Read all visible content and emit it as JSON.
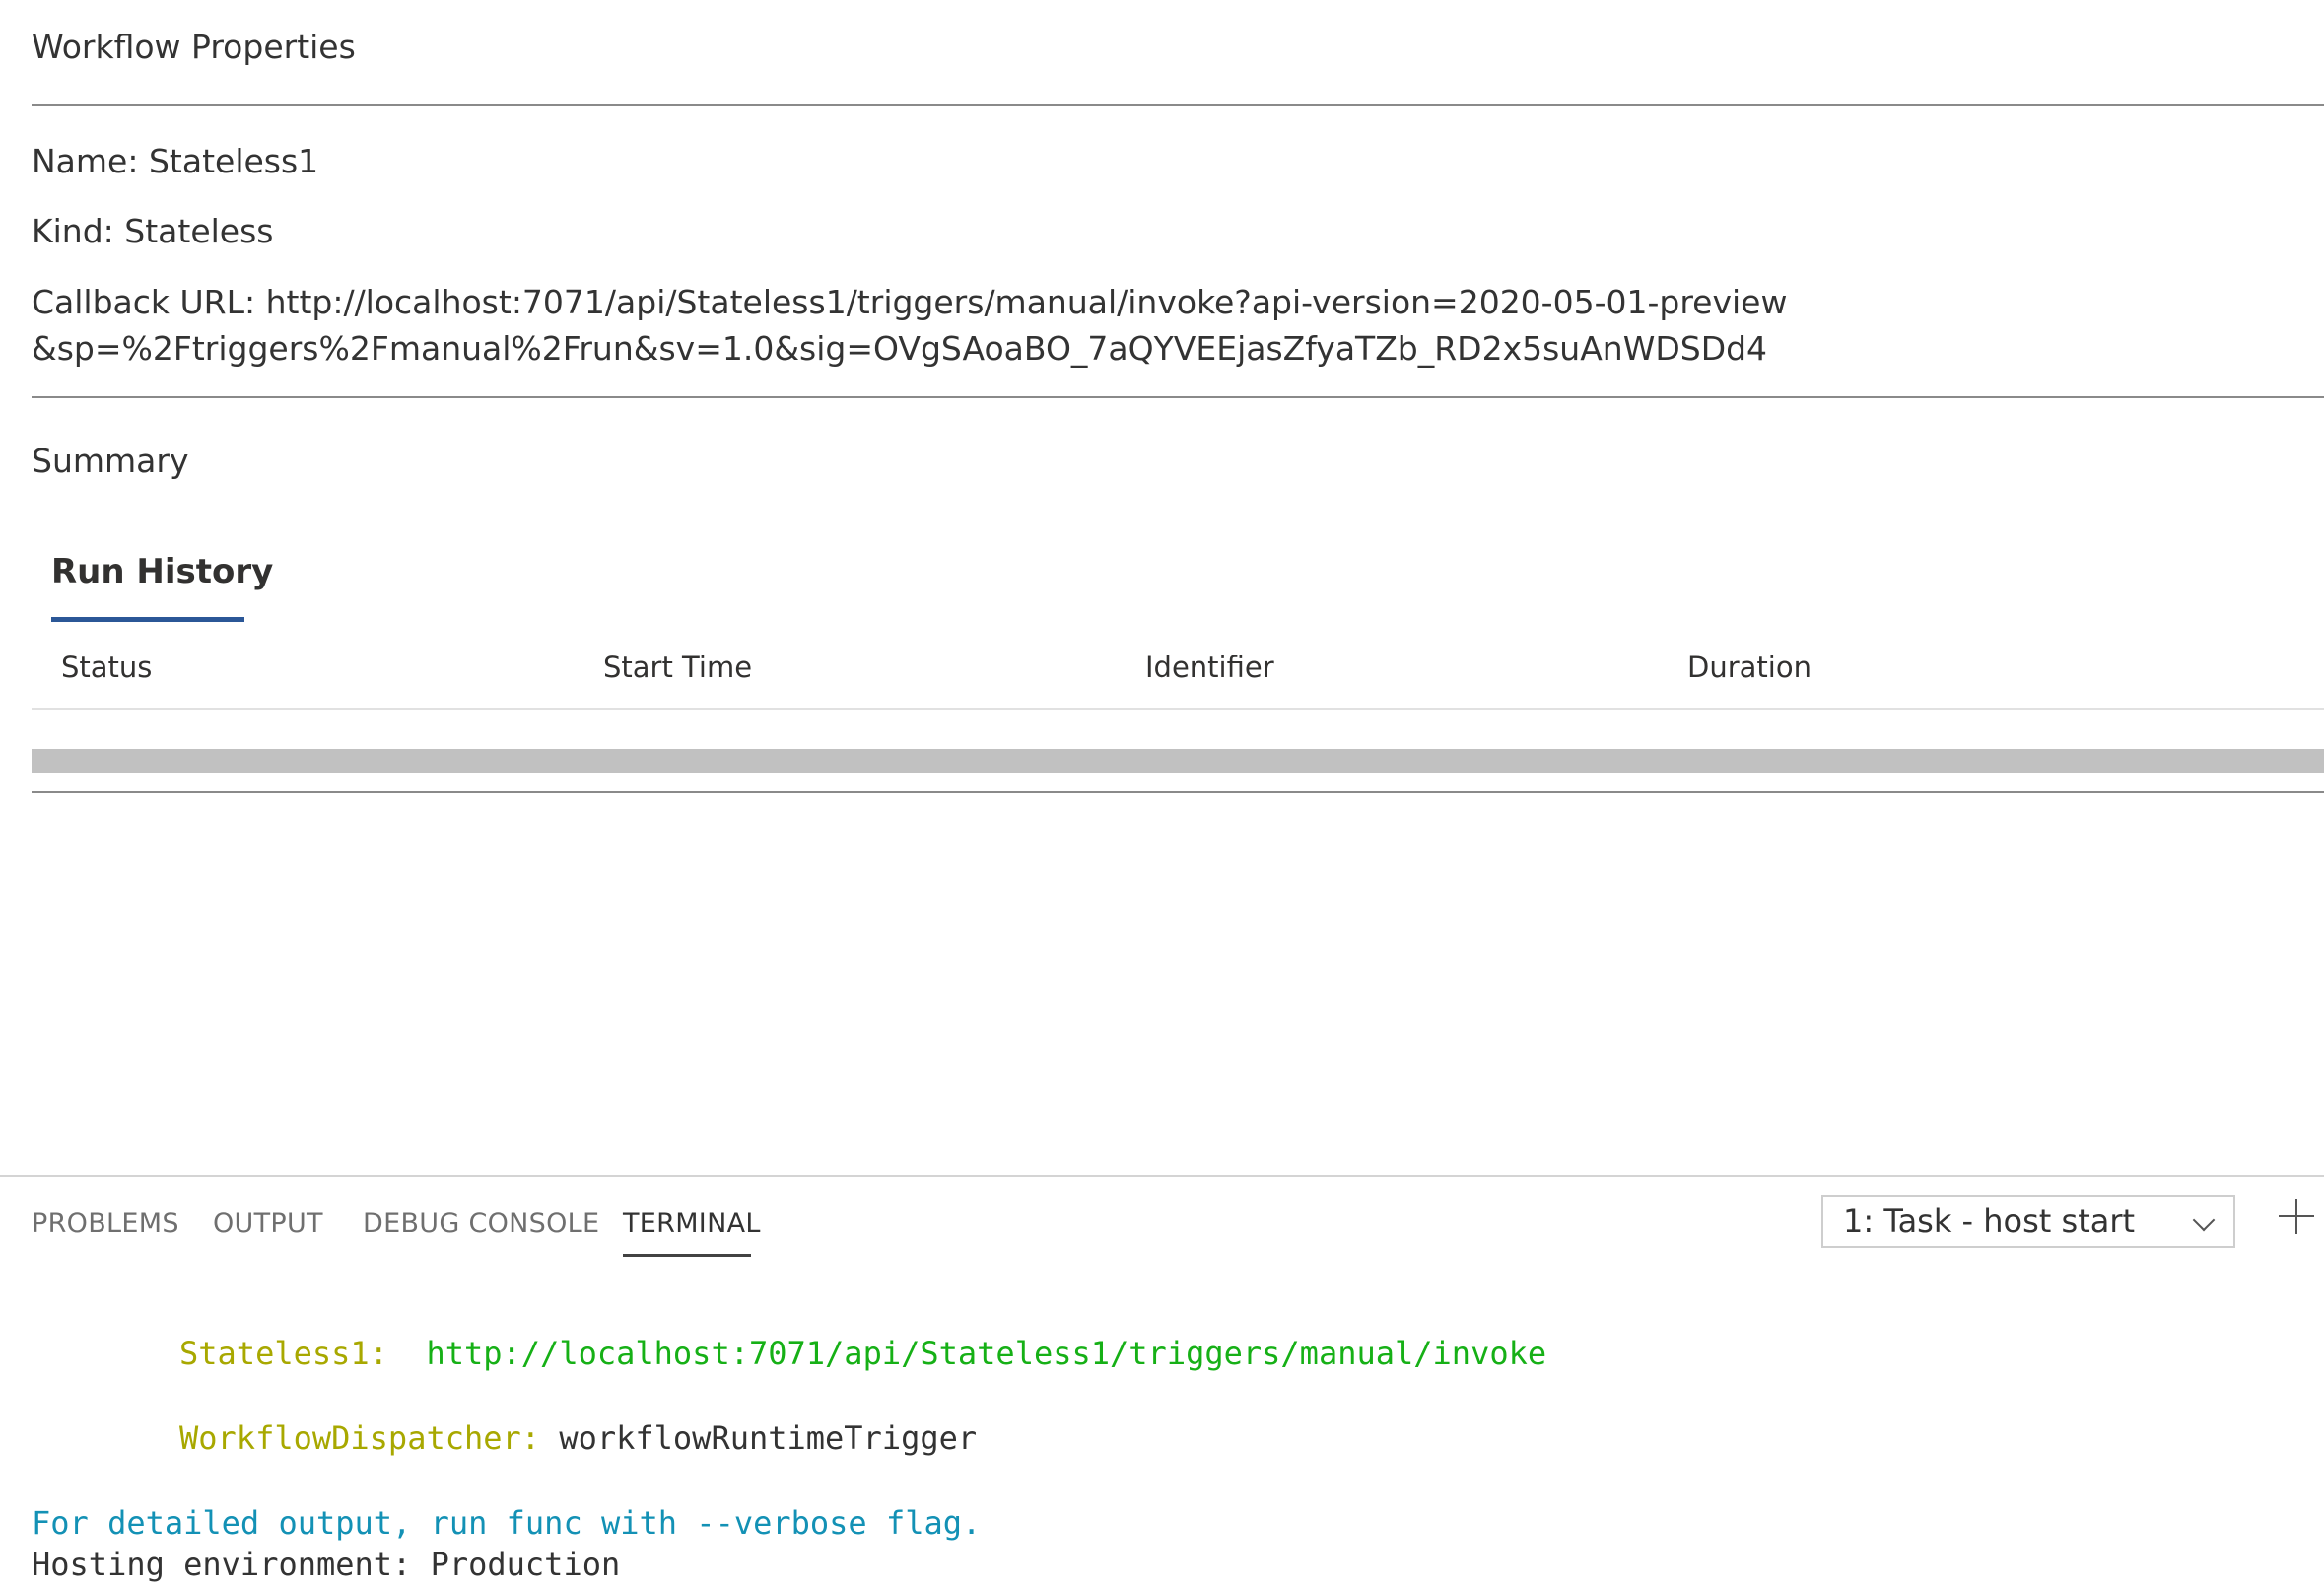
{
  "properties": {
    "title": "Workflow Properties",
    "name_line": "Name: Stateless1",
    "kind_line": "Kind: Stateless",
    "callback_line": "Callback URL: http://localhost:7071/api/Stateless1/triggers/manual/invoke?api-version=2020-05-01-preview&sp=%2Ftriggers%2Fmanual%2Frun&sv=1.0&sig=OVgSAoaBO_7aQYVEEjasZfyaTZb_RD2x5suAnWDSDd4",
    "summary_title": "Summary"
  },
  "run_history": {
    "tab_label": "Run History",
    "columns": [
      "Status",
      "Start Time",
      "Identifier",
      "Duration"
    ]
  },
  "panel": {
    "tabs": [
      "PROBLEMS",
      "OUTPUT",
      "DEBUG CONSOLE",
      "TERMINAL"
    ],
    "active_tab": "TERMINAL",
    "terminal_select": "1: Task - host start"
  },
  "terminal": {
    "line1_label": "Stateless1:",
    "line1_value": "http://localhost:7071/api/Stateless1/triggers/manual/invoke",
    "line2_label": "WorkflowDispatcher:",
    "line2_value": "workflowRuntimeTrigger",
    "line3": "For detailed output, run func with --verbose flag.",
    "line4": "Hosting environment: Production"
  },
  "colors": {
    "accent": "#2b5797",
    "terminal_yellow": "#a8a800",
    "terminal_green": "#16b016",
    "terminal_cyan": "#1391b5"
  }
}
